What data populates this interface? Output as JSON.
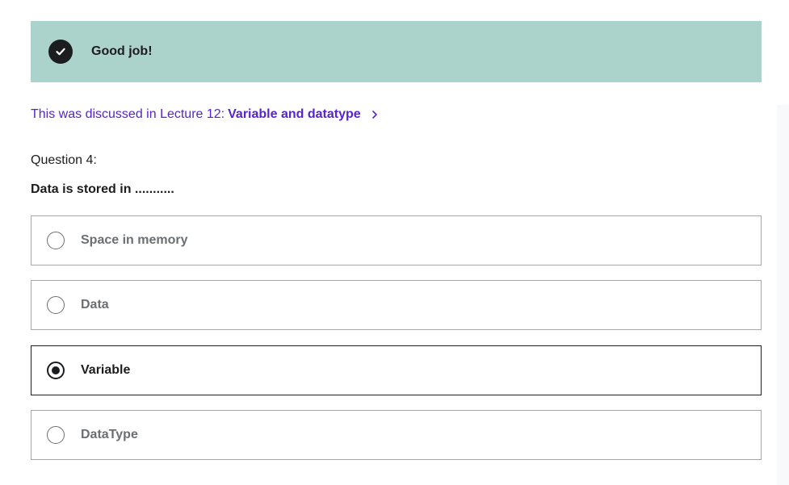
{
  "feedback": {
    "message": "Good job!",
    "icon": "check-circle-icon",
    "background_color": "#acd2cc"
  },
  "reference": {
    "prefix": "This was discussed in Lecture 12:",
    "lecture_title": "Variable and datatype",
    "icon": "chevron-right-icon",
    "link_color": "#5624d0"
  },
  "question": {
    "number_label": "Question 4:",
    "prompt": "Data is stored in ...........",
    "options": [
      {
        "label": "Space in memory",
        "selected": false
      },
      {
        "label": "Data",
        "selected": false
      },
      {
        "label": "Variable",
        "selected": true
      },
      {
        "label": "DataType",
        "selected": false
      }
    ]
  }
}
